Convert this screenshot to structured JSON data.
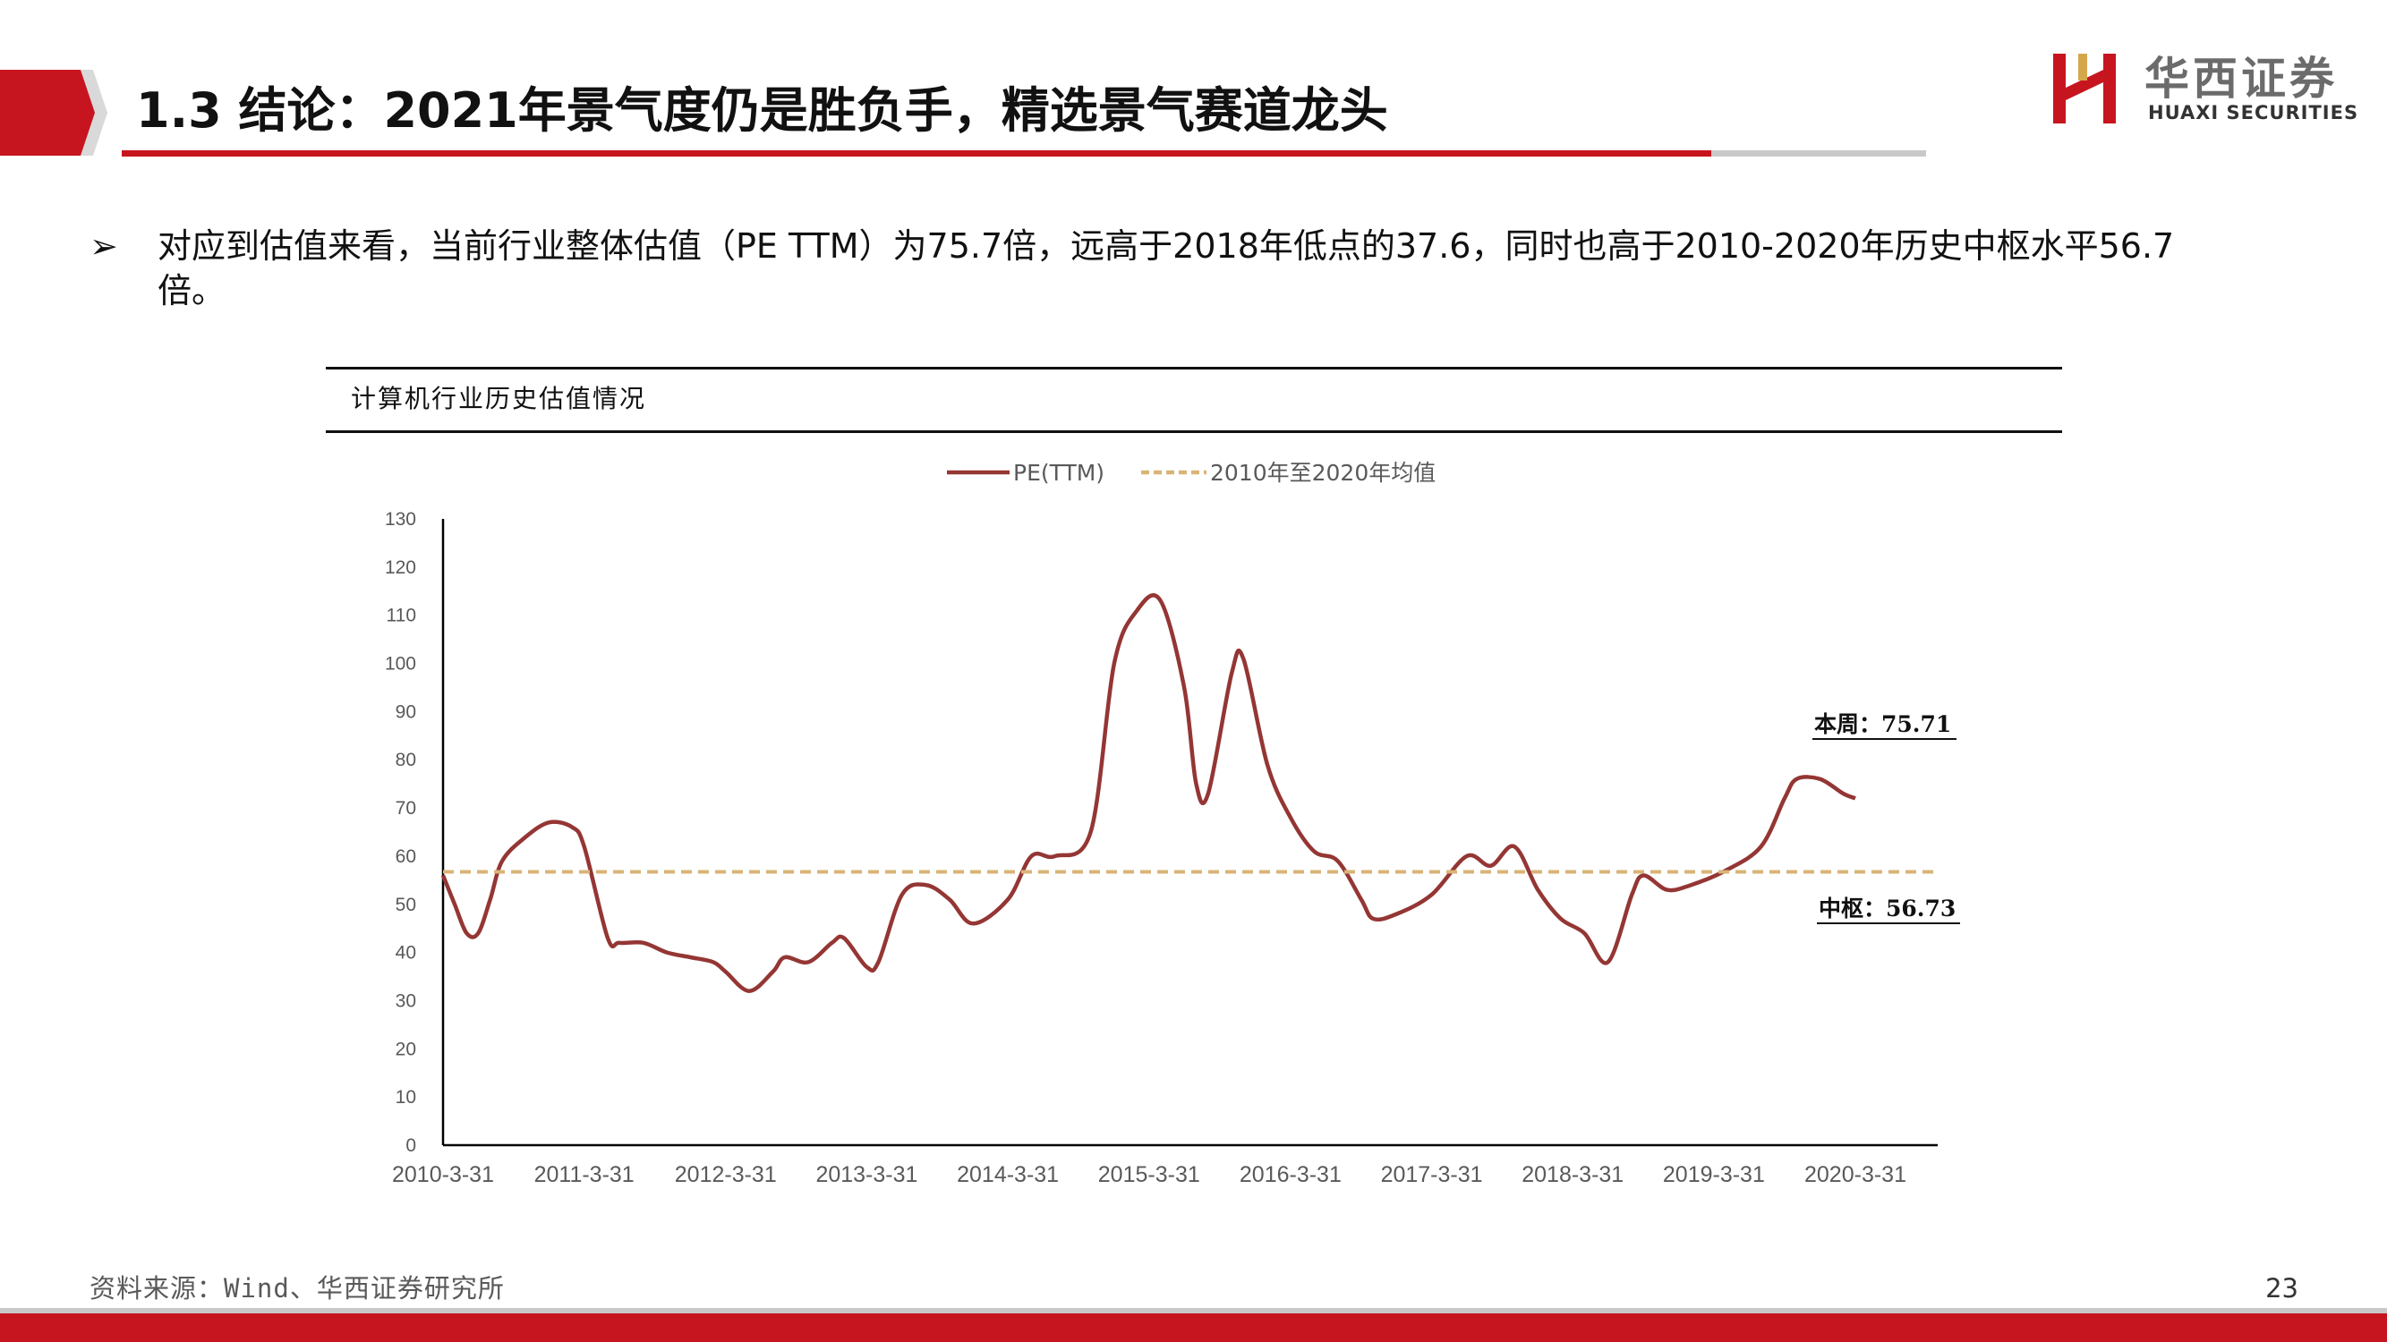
{
  "header": {
    "title": "1.3 结论：2021年景气度仍是胜负手，精选景气赛道龙头",
    "logo_cn": "华西证券",
    "logo_en": "HUAXI SECURITIES"
  },
  "bullet": {
    "marker": "➢",
    "line1": "对应到估值来看，当前行业整体估值（PE TTM）为75.7倍，远高于2018年低点的37.6，同时也高于2010-2020年历史中枢水平56.7",
    "line2": "倍。"
  },
  "chart_caption": "计算机行业历史估值情况",
  "chart_data": {
    "type": "line",
    "title": "",
    "x_ticks": [
      "2010-3-31",
      "2011-3-31",
      "2012-3-31",
      "2013-3-31",
      "2014-3-31",
      "2015-3-31",
      "2016-3-31",
      "2017-3-31",
      "2018-3-31",
      "2019-3-31",
      "2020-3-31"
    ],
    "y_ticks": [
      "0",
      "10",
      "20",
      "30",
      "40",
      "50",
      "60",
      "70",
      "80",
      "90",
      "100",
      "110",
      "120",
      "130"
    ],
    "ylim": [
      0,
      130
    ],
    "x_range": [
      "2010-03-31",
      "2020-12-31"
    ],
    "grid": false,
    "legend_position": "top-center",
    "series": [
      {
        "name": "PE(TTM)",
        "color": "#943634",
        "style": "solid",
        "points": [
          [
            "2010-03-31",
            56
          ],
          [
            "2010-04-30",
            50
          ],
          [
            "2010-05-31",
            44
          ],
          [
            "2010-06-30",
            44
          ],
          [
            "2010-07-31",
            51
          ],
          [
            "2010-08-31",
            59
          ],
          [
            "2010-10-31",
            64
          ],
          [
            "2010-12-31",
            67
          ],
          [
            "2011-02-28",
            66
          ],
          [
            "2011-03-31",
            62
          ],
          [
            "2011-05-31",
            43
          ],
          [
            "2011-06-30",
            42
          ],
          [
            "2011-08-31",
            42
          ],
          [
            "2011-10-31",
            40
          ],
          [
            "2011-12-31",
            39
          ],
          [
            "2012-02-28",
            38
          ],
          [
            "2012-03-31",
            36
          ],
          [
            "2012-05-31",
            32
          ],
          [
            "2012-07-31",
            36
          ],
          [
            "2012-08-31",
            39
          ],
          [
            "2012-10-31",
            38
          ],
          [
            "2012-12-31",
            42
          ],
          [
            "2013-01-31",
            43
          ],
          [
            "2013-03-31",
            37
          ],
          [
            "2013-04-30",
            38
          ],
          [
            "2013-06-30",
            52
          ],
          [
            "2013-08-31",
            54
          ],
          [
            "2013-10-31",
            51
          ],
          [
            "2013-12-31",
            46
          ],
          [
            "2014-03-31",
            51
          ],
          [
            "2014-05-31",
            60
          ],
          [
            "2014-07-31",
            60
          ],
          [
            "2014-10-31",
            65
          ],
          [
            "2014-12-31",
            100
          ],
          [
            "2015-02-28",
            111
          ],
          [
            "2015-04-30",
            113
          ],
          [
            "2015-06-30",
            95
          ],
          [
            "2015-07-31",
            75
          ],
          [
            "2015-08-31",
            73
          ],
          [
            "2015-10-31",
            98
          ],
          [
            "2015-11-30",
            101
          ],
          [
            "2016-01-31",
            79
          ],
          [
            "2016-03-31",
            68
          ],
          [
            "2016-05-31",
            61
          ],
          [
            "2016-07-31",
            59
          ],
          [
            "2016-09-30",
            51
          ],
          [
            "2016-10-31",
            47
          ],
          [
            "2016-12-31",
            48
          ],
          [
            "2017-03-31",
            52
          ],
          [
            "2017-06-30",
            60
          ],
          [
            "2017-08-31",
            58
          ],
          [
            "2017-10-31",
            62
          ],
          [
            "2017-12-31",
            53
          ],
          [
            "2018-02-28",
            47
          ],
          [
            "2018-04-30",
            44
          ],
          [
            "2018-06-30",
            38
          ],
          [
            "2018-08-31",
            52
          ],
          [
            "2018-09-30",
            56
          ],
          [
            "2018-11-30",
            53
          ],
          [
            "2019-01-31",
            54
          ],
          [
            "2019-04-30",
            57
          ],
          [
            "2019-07-31",
            62
          ],
          [
            "2019-09-30",
            72
          ],
          [
            "2019-10-31",
            76
          ],
          [
            "2019-12-31",
            76
          ],
          [
            "2020-02-28",
            73
          ],
          [
            "2020-03-31",
            72
          ]
        ]
      },
      {
        "name": "2010年至2020年均值",
        "color": "#d9b477",
        "style": "dashed",
        "points": [
          [
            "2010-03-31",
            56.73
          ],
          [
            "2020-12-31",
            56.73
          ]
        ]
      }
    ],
    "annotations": [
      {
        "label": "本周：75.71",
        "value": 75.71
      },
      {
        "label": "中枢：56.73",
        "value": 56.73
      }
    ]
  },
  "source": "资料来源：Wind、华西证券研究所",
  "page_number": "23"
}
